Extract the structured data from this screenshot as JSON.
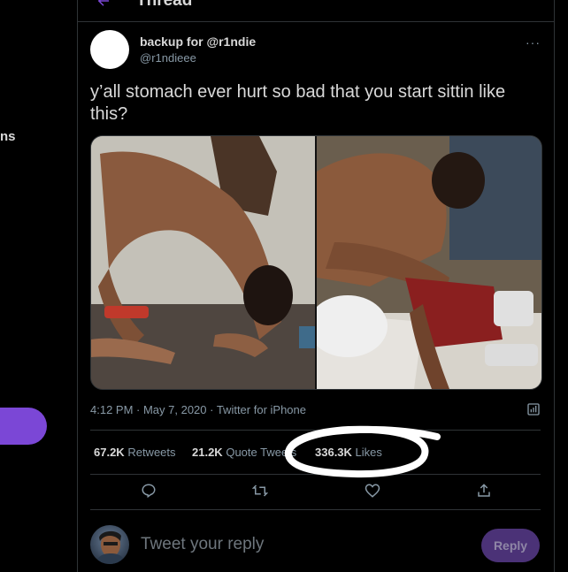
{
  "sidebar": {
    "cut_text": "ns"
  },
  "header": {
    "title": "Thread"
  },
  "tweet": {
    "display_name": "backup for @r1ndie",
    "handle": "@r1ndieee",
    "text": "y’all stomach ever hurt so bad that you start sittin like this?",
    "timestamp": "4:12 PM · May 7, 2020 · Twitter for iPhone",
    "more_icon": "more-horizontal-icon"
  },
  "stats": {
    "retweets_num": "67.2K",
    "retweets_label": "Retweets",
    "quotes_num": "21.2K",
    "quotes_label": "Quote Tweets",
    "likes_num": "336.3K",
    "likes_label": "Likes"
  },
  "actions": {
    "icons": [
      "reply-icon",
      "retweet-icon",
      "like-icon",
      "share-icon"
    ]
  },
  "reply": {
    "placeholder": "Tweet your reply",
    "button_label": "Reply"
  },
  "colors": {
    "background": "#000000",
    "accent": "#7b47d6",
    "border": "#2f3336",
    "secondary_text": "#8899a6"
  }
}
